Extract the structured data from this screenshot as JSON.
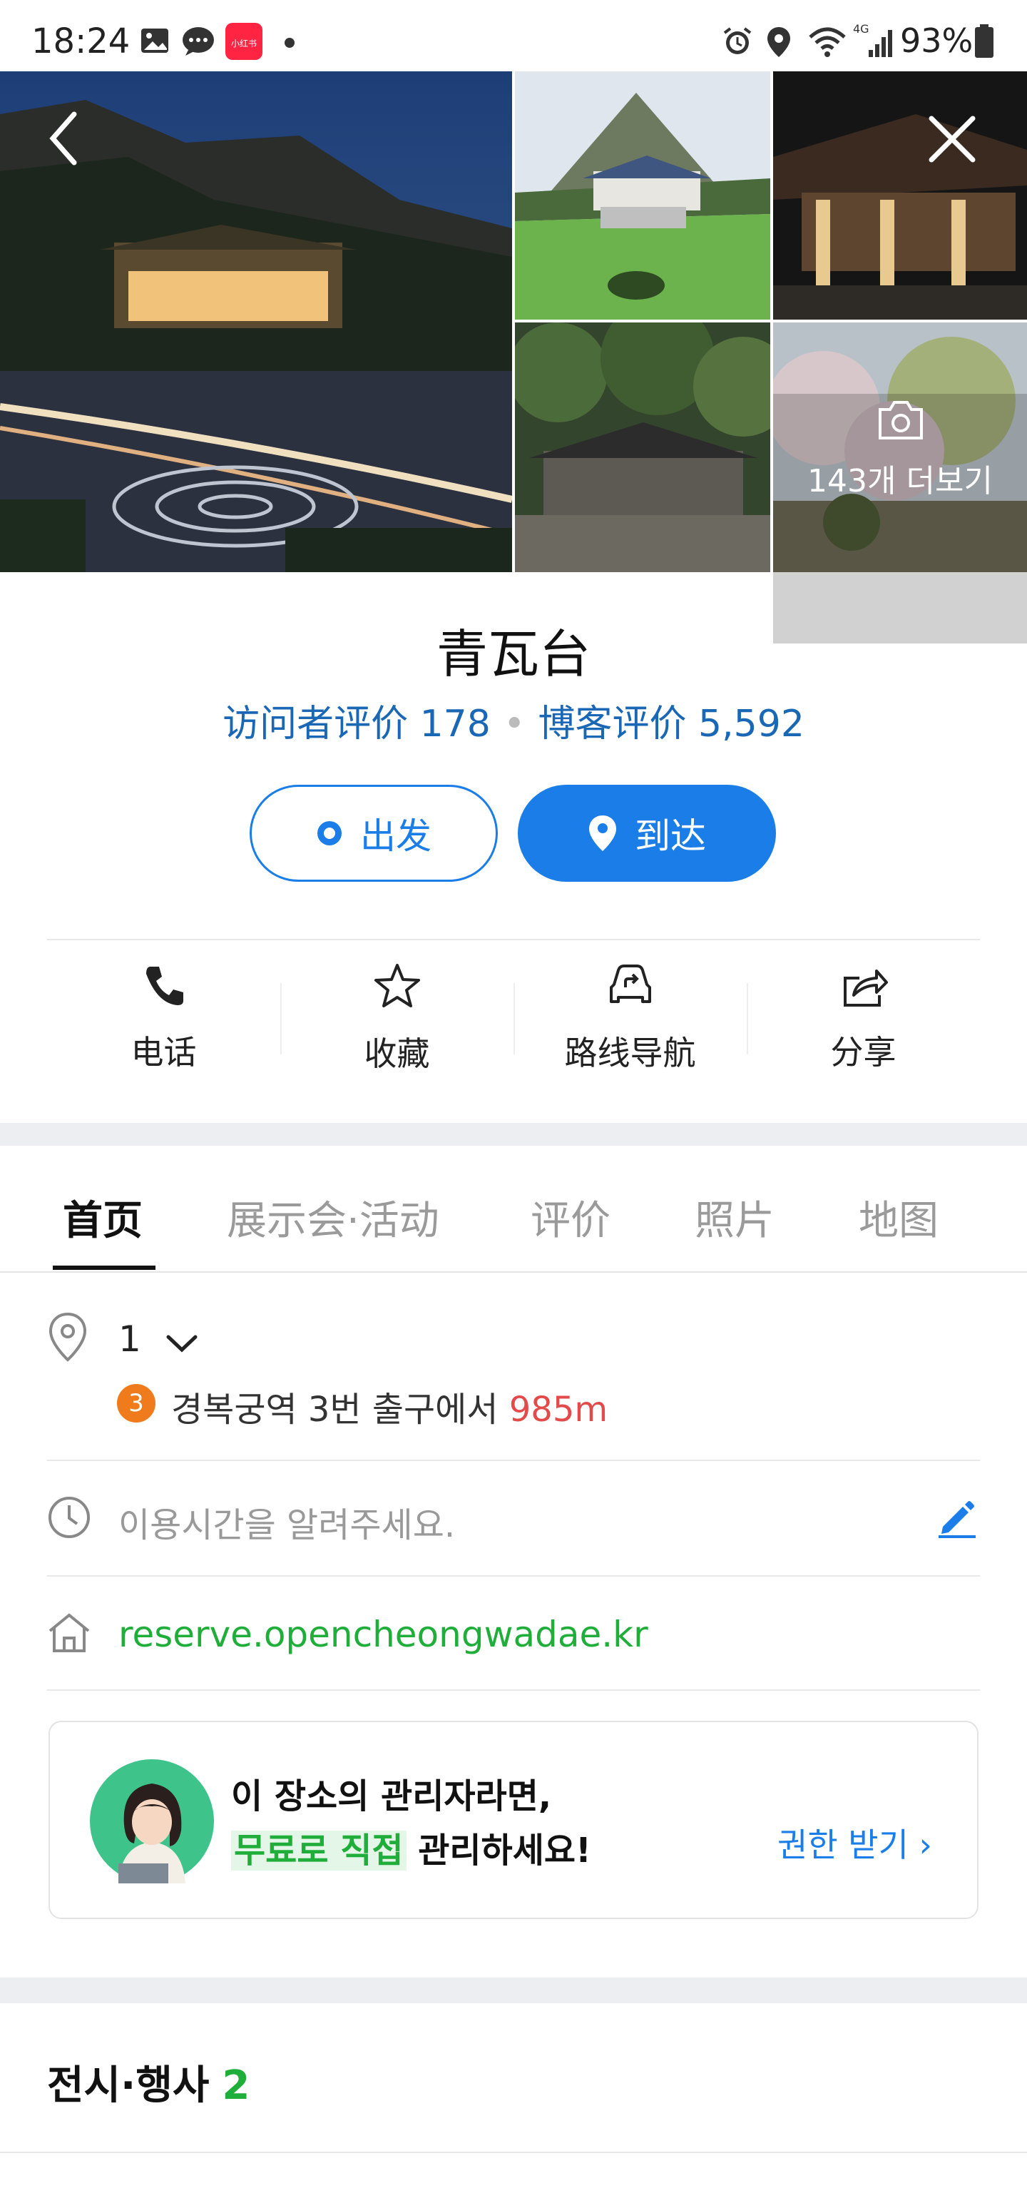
{
  "status_bar": {
    "time": "18:24",
    "battery": "93%",
    "icons": [
      "gallery-icon",
      "message-icon",
      "xiaohongshu-app-icon",
      "dot-icon",
      "alarm-icon",
      "location-icon",
      "wifi-icon",
      "4g-signal-icon",
      "battery-icon"
    ],
    "app_badge": "小红书"
  },
  "photos": {
    "more_label": "143개 더보기"
  },
  "place": {
    "title": "青瓦台",
    "visitor_reviews_label": "访问者评价 178",
    "blog_reviews_label": "博客评价 5,592",
    "separator": "•"
  },
  "buttons": {
    "depart": "出发",
    "arrive": "到达"
  },
  "actions": [
    {
      "label": "电话",
      "icon": "phone-icon"
    },
    {
      "label": "收藏",
      "icon": "star-icon"
    },
    {
      "label": "路线导航",
      "icon": "car-route-icon"
    },
    {
      "label": "分享",
      "icon": "share-icon"
    }
  ],
  "tabs": [
    "首页",
    "展示会·活动",
    "评价",
    "照片",
    "地图"
  ],
  "active_tab": "首页",
  "info": {
    "address_value": "1",
    "subway_line": "3",
    "subway_station": "경복궁역 3번 출구에서",
    "subway_distance": "985m",
    "hours_placeholder": "이용시간을 알려주세요.",
    "website": "reserve.opencheongwadae.kr"
  },
  "owner_card": {
    "line1": "이 장소의 관리자라면,",
    "line2_highlight": "무료로 직접",
    "line2_rest": "관리하세요!",
    "claim_link": "권한 받기 ›"
  },
  "exhibitions": {
    "title": "전시·행사",
    "count": "2"
  },
  "colors": {
    "accent_blue": "#1a7de8",
    "review_blue": "#1a67b5",
    "green": "#1fae3a",
    "distance_red": "#e34b4b",
    "subway_orange": "#f07b1c"
  }
}
